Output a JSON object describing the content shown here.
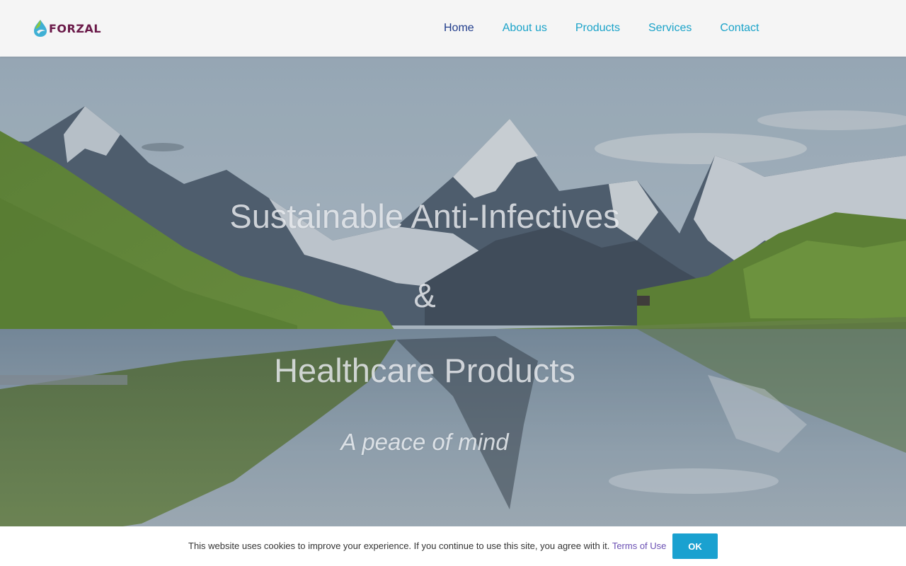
{
  "brand": {
    "name": "FORZAL",
    "logo_icon": "leaf-drop-icon",
    "name_color": "#6b1b4a"
  },
  "nav": {
    "items": [
      {
        "label": "Home",
        "active": true
      },
      {
        "label": "About us",
        "active": false
      },
      {
        "label": "Products",
        "active": false
      },
      {
        "label": "Services",
        "active": false
      },
      {
        "label": "Contact",
        "active": false
      }
    ],
    "active_color": "#213d8c",
    "link_color": "#1ba3c9"
  },
  "hero": {
    "line1": "Sustainable Anti-Infectives",
    "line2": "&",
    "line3": "Healthcare Products",
    "tagline": "A peace of mind"
  },
  "cookie": {
    "message": "This website uses cookies to improve your experience. If you continue to use this site, you agree with it.",
    "link_label": "Terms of Use",
    "ok_label": "OK",
    "button_color": "#1aa1d0"
  }
}
